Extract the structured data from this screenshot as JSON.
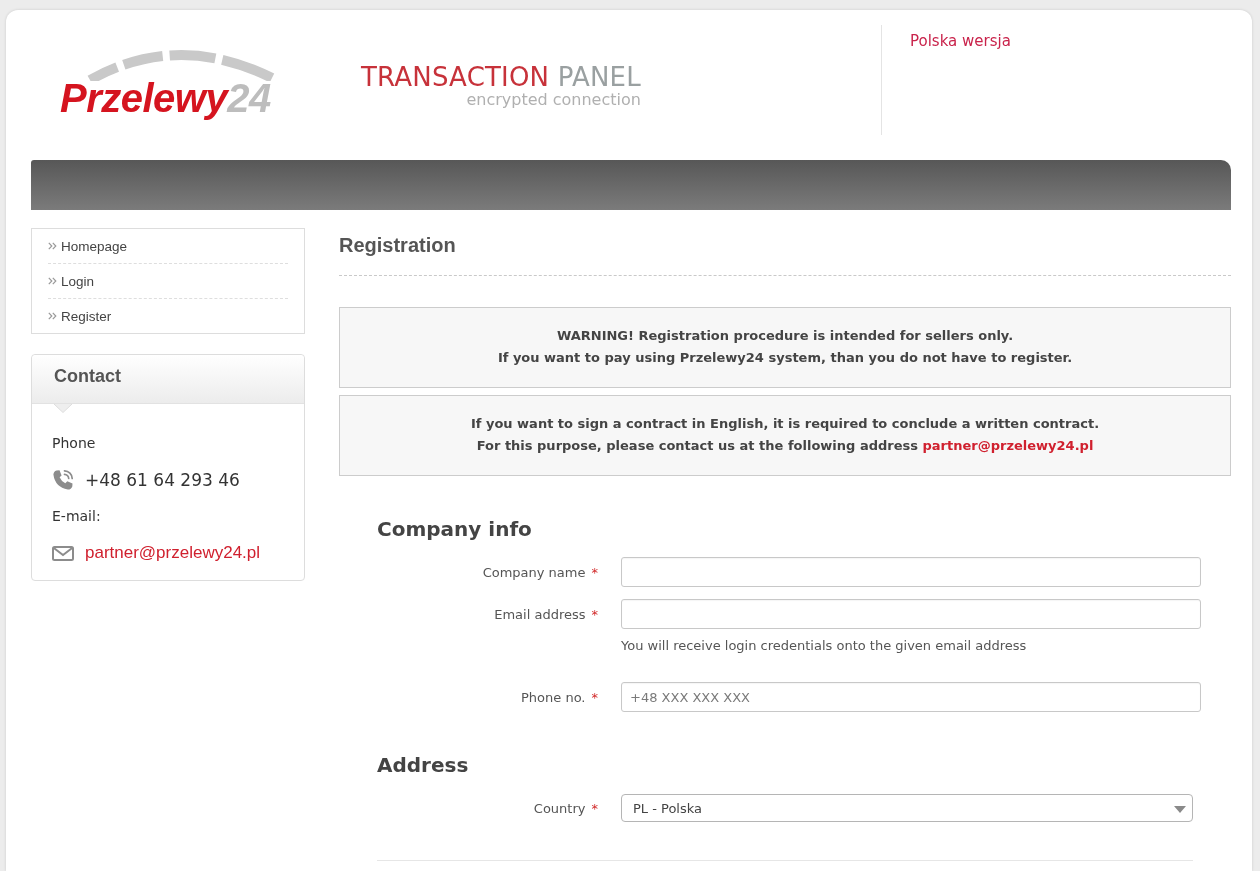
{
  "header": {
    "logo": {
      "name": "Przelewy",
      "number": "24"
    },
    "panel_logo": {
      "title": "TRANSACTION",
      "title_accent": "PANEL",
      "subtitle": "encrypted connection"
    },
    "language_link": "Polska wersja"
  },
  "sidebar": {
    "menu": [
      {
        "label": "Homepage"
      },
      {
        "label": "Login"
      },
      {
        "label": "Register"
      }
    ],
    "contact": {
      "title": "Contact",
      "phone_label": "Phone",
      "phone": "+48 61 64 293 46",
      "email_label": "E-mail:",
      "email": "partner@przelewy24.pl"
    }
  },
  "main": {
    "title": "Registration",
    "notices": [
      {
        "lines": [
          {
            "text": "WARNING! Registration procedure is intended for sellers only."
          },
          {
            "text": "If you want to pay using Przelewy24 system, than you do not have to register."
          }
        ]
      },
      {
        "lines": [
          {
            "text": "If you want to sign a contract in English, it is required to conclude a written contract."
          },
          {
            "text": "For this purpose, please contact us at the following address",
            "link": "partner@przelewy24.pl"
          }
        ]
      }
    ],
    "form_sections": [
      {
        "title": "Company info",
        "fields": [
          {
            "kind": "text",
            "label": "Company name",
            "required_mark": "*"
          },
          {
            "kind": "text",
            "label": "Email address",
            "required_mark": "*",
            "hint": "You will receive login credentials onto the given email address"
          },
          {
            "kind": "text",
            "label": "Phone no.",
            "required_mark": "*",
            "placeholder": "+48 XXX XXX XXX"
          }
        ]
      },
      {
        "title": "Address",
        "fields": [
          {
            "kind": "select",
            "label": "Country",
            "required_mark": "*",
            "value": "PL - Polska"
          }
        ]
      }
    ]
  }
}
